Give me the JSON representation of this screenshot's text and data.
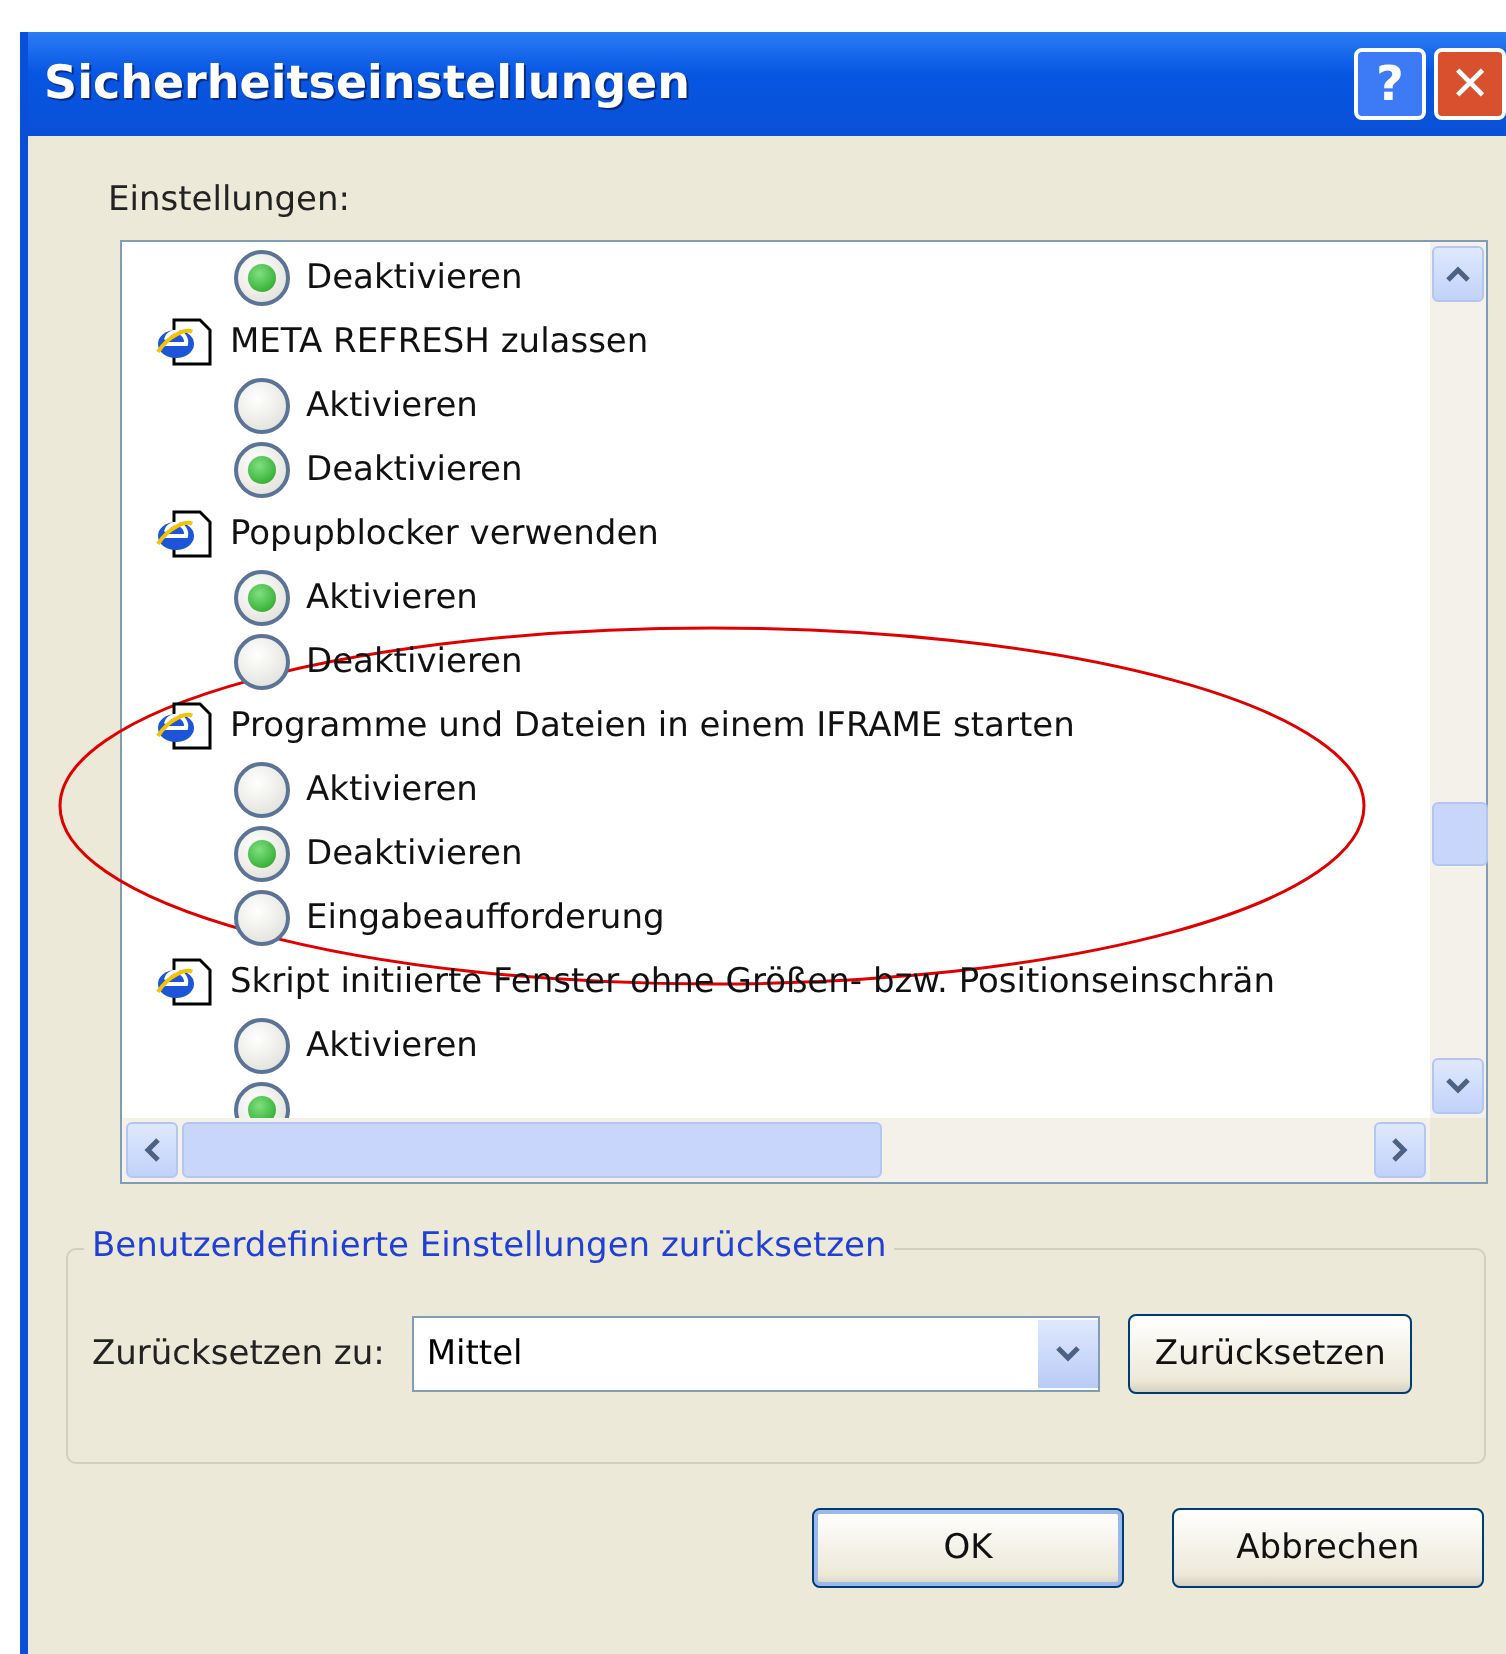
{
  "window": {
    "title": "Sicherheitseinstellungen",
    "buttons": [
      {
        "kind": "help",
        "label": "?"
      },
      {
        "kind": "close",
        "label": "✕"
      }
    ]
  },
  "settings_label": "Einstellungen:",
  "settings": [
    {
      "options": [
        {
          "label": "Deaktivieren",
          "selected": true
        }
      ]
    },
    {
      "label": "META REFRESH zulassen",
      "options": [
        {
          "label": "Aktivieren",
          "selected": false
        },
        {
          "label": "Deaktivieren",
          "selected": true
        }
      ]
    },
    {
      "label": "Popupblocker verwenden",
      "options": [
        {
          "label": "Aktivieren",
          "selected": true
        },
        {
          "label": "Deaktivieren",
          "selected": false
        }
      ]
    },
    {
      "label": "Programme und Dateien in einem IFRAME starten",
      "options": [
        {
          "label": "Aktivieren",
          "selected": false
        },
        {
          "label": "Deaktivieren",
          "selected": true
        },
        {
          "label": "Eingabeaufforderung",
          "selected": false
        }
      ]
    },
    {
      "label": "Skript initiierte Fenster ohne Größen- bzw. Positionseinschrän",
      "options": [
        {
          "label": "Aktivieren",
          "selected": false
        },
        {
          "selected": true
        }
      ]
    }
  ],
  "annotation": {
    "kind": "ellipse"
  },
  "reset_group": {
    "title": "Benutzerdefinierte Einstellungen zurücksetzen",
    "label": "Zurücksetzen zu:",
    "value": "Mittel",
    "button": "Zurücksetzen"
  },
  "buttons": [
    {
      "label": "OK",
      "default": true
    },
    {
      "label": "Abbrechen",
      "default": false
    }
  ]
}
